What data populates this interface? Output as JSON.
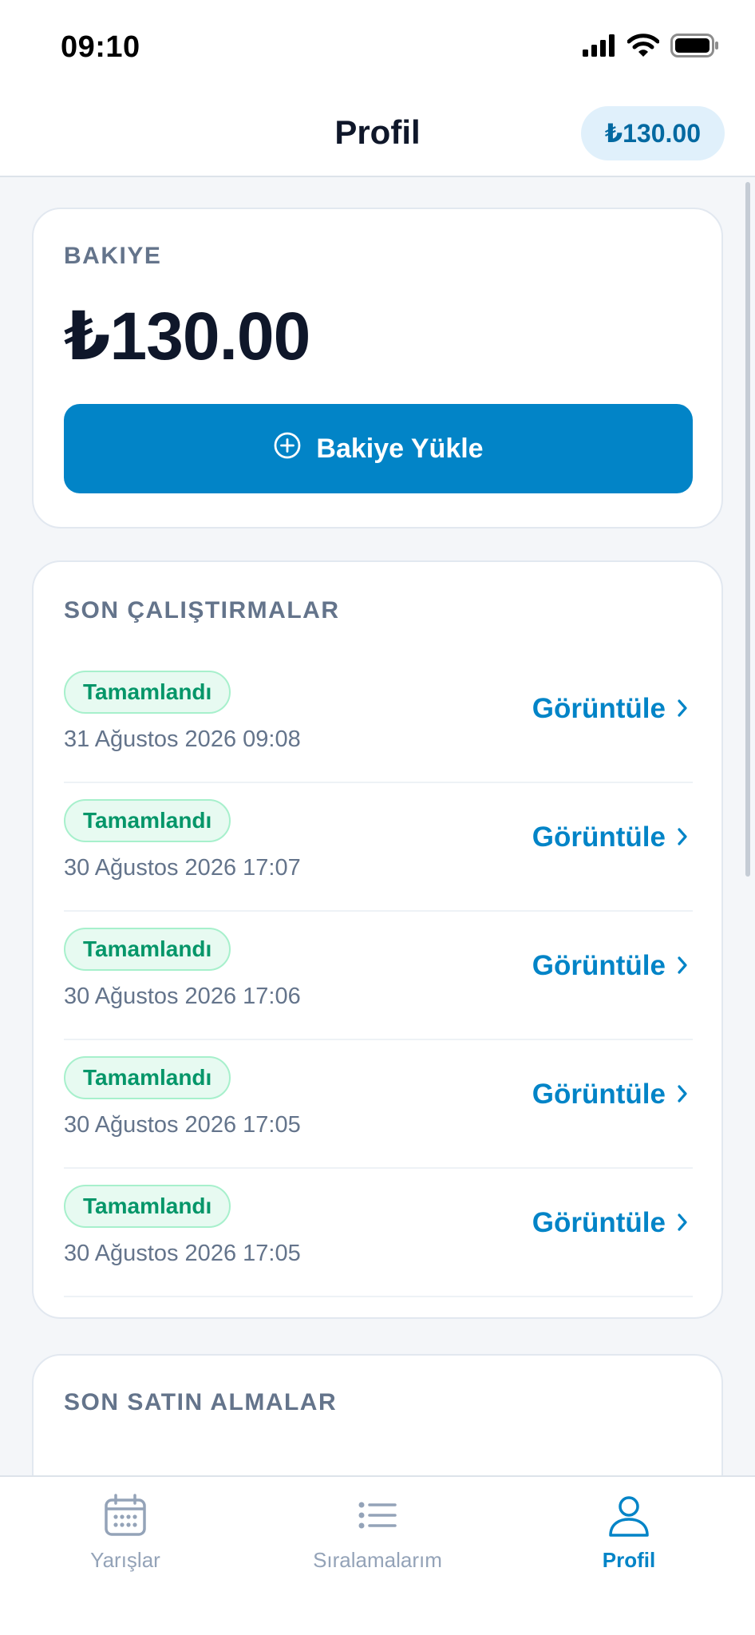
{
  "status_bar": {
    "time": "09:10"
  },
  "header": {
    "title": "Profil",
    "balance_pill": "₺130.00"
  },
  "balance_card": {
    "label": "BAKIYE",
    "amount": "₺130.00",
    "topup_label": "Bakiye Yükle"
  },
  "runs": {
    "label": "SON ÇALIŞTIRMALAR",
    "items": [
      {
        "status": "Tamamlandı",
        "date": "31 Ağustos 2026 09:08",
        "action": "Görüntüle"
      },
      {
        "status": "Tamamlandı",
        "date": "30 Ağustos 2026 17:07",
        "action": "Görüntüle"
      },
      {
        "status": "Tamamlandı",
        "date": "30 Ağustos 2026 17:06",
        "action": "Görüntüle"
      },
      {
        "status": "Tamamlandı",
        "date": "30 Ağustos 2026 17:05",
        "action": "Görüntüle"
      },
      {
        "status": "Tamamlandı",
        "date": "30 Ağustos 2026 17:05",
        "action": "Görüntüle"
      }
    ]
  },
  "purchases": {
    "label": "SON SATIN ALMALAR"
  },
  "tabs": [
    {
      "label": "Yarışlar",
      "icon": "calendar-icon",
      "active": false
    },
    {
      "label": "Sıralamalarım",
      "icon": "list-icon",
      "active": false
    },
    {
      "label": "Profil",
      "icon": "user-icon",
      "active": true
    }
  ],
  "colors": {
    "accent": "#0284c7",
    "success": "#059669",
    "success_bg": "#e7faf1",
    "muted": "#64748b",
    "inactive_tab": "#94a3b8"
  }
}
